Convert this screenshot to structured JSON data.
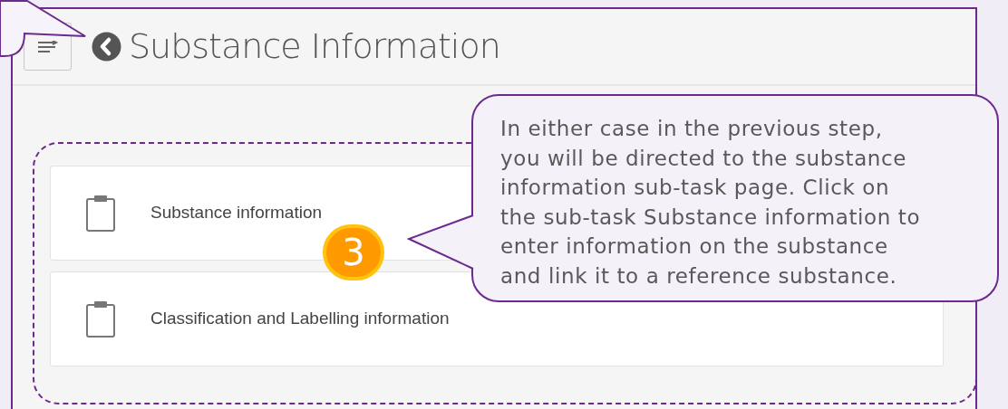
{
  "header": {
    "title": "Substance Information"
  },
  "subtasks": [
    {
      "label": "Substance information"
    },
    {
      "label": "Classification and Labelling information"
    }
  ],
  "step_badge": {
    "number": "3"
  },
  "callout": {
    "lines": [
      "In either case in the previous step,",
      "you will be directed to the substance",
      "information sub-task page. Click on",
      "the sub-task Substance information to",
      "enter information on the substance",
      "and link it to a reference substance."
    ]
  }
}
